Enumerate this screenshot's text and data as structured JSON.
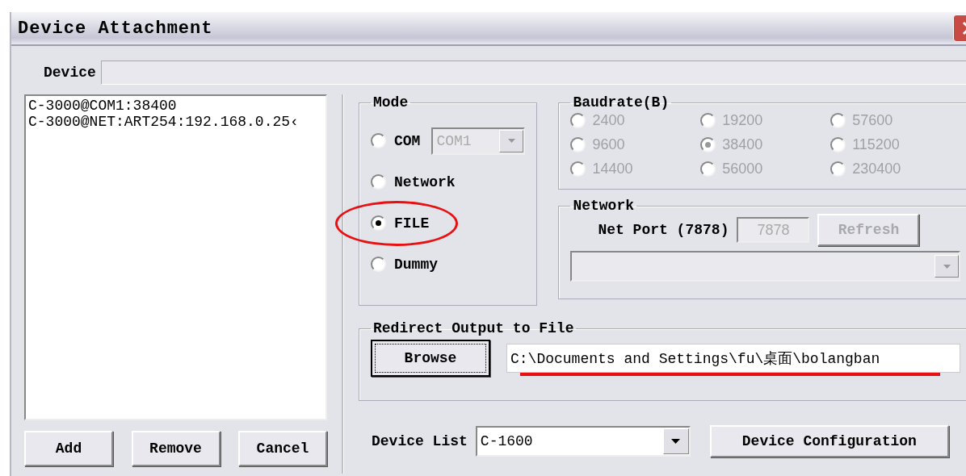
{
  "window": {
    "title": "Device Attachment"
  },
  "device": {
    "label": "Device"
  },
  "device_entries": [
    {
      "text": "C-3000@COM1:38400",
      "selected": false
    },
    {
      "text": "C-3000@NET:ART254:192.168.0.25‹",
      "selected": false
    }
  ],
  "list_buttons": [
    "Add",
    "Remove",
    "Cancel"
  ],
  "mode": {
    "title": "Mode",
    "options": [
      {
        "label": "COM",
        "selected": false,
        "circled": false,
        "kind": "port"
      },
      {
        "label": "Network",
        "selected": false,
        "circled": false,
        "kind": "plain"
      },
      {
        "label": "FILE",
        "selected": true,
        "circled": true,
        "kind": "plain"
      },
      {
        "label": "Dummy",
        "selected": false,
        "circled": false,
        "kind": "plain"
      }
    ],
    "port": {
      "value": "COM1",
      "disabled": true
    }
  },
  "baudrate": {
    "title": "Baudrate(B)",
    "disabled": true,
    "options": [
      {
        "label": "2400",
        "selected": false
      },
      {
        "label": "19200",
        "selected": false
      },
      {
        "label": "57600",
        "selected": false
      },
      {
        "label": "9600",
        "selected": false
      },
      {
        "label": "38400",
        "selected": true
      },
      {
        "label": "115200",
        "selected": false
      },
      {
        "label": "14400",
        "selected": false
      },
      {
        "label": "56000",
        "selected": false
      },
      {
        "label": "230400",
        "selected": false
      }
    ]
  },
  "network": {
    "title": "Network",
    "port_label": "Net Port (7878)",
    "port_value": "7878",
    "refresh": "Refresh",
    "disabled": true
  },
  "redirect": {
    "title": "Redirect Output to File",
    "browse": "Browse",
    "path": "C:\\Documents and Settings\\fu\\桌面\\bolangban",
    "underlined": true
  },
  "device_list": {
    "label": "Device List",
    "value": "C-1600",
    "configure": "Device Configuration"
  }
}
